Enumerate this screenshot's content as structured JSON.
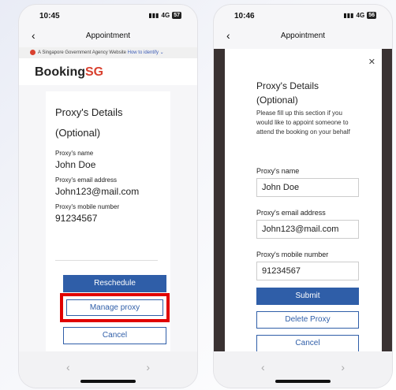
{
  "left_phone": {
    "status_time": "10:45",
    "status_signal": "4G",
    "battery": "57",
    "nav_title": "Appointment",
    "gov_banner_text": "A Singapore Government Agency Website",
    "gov_banner_link": "How to identify",
    "brand_prefix": "Booking",
    "brand_suffix": "SG",
    "proxy_title_line1": "Proxy's Details",
    "proxy_title_line2": "(Optional)",
    "name_label": "Proxy's name",
    "name_value": "John Doe",
    "email_label": "Proxy's email address",
    "email_value": "John123@mail.com",
    "mobile_label": "Proxy's mobile number",
    "mobile_value": "91234567",
    "reschedule_label": "Reschedule",
    "manage_proxy_label": "Manage proxy",
    "cancel_label": "Cancel"
  },
  "right_phone": {
    "status_time": "10:46",
    "status_signal": "4G",
    "battery": "56",
    "nav_title": "Appointment",
    "proxy_title_line1": "Proxy's Details",
    "proxy_title_line2": "(Optional)",
    "helper_text": "Please fill up this section if you would like to appoint someone to attend the booking on your behalf",
    "name_label": "Proxy's name",
    "name_value": "John Doe",
    "email_label": "Proxy's email address",
    "email_value": "John123@mail.com",
    "mobile_label": "Proxy's mobile number",
    "mobile_value": "91234567",
    "submit_label": "Submit",
    "delete_label": "Delete Proxy",
    "cancel_label": "Cancel"
  },
  "colors": {
    "primary": "#2f5ea8",
    "highlight": "#e00000",
    "brand_accent": "#d9412f"
  },
  "icons": [
    "back-chevron-icon",
    "close-icon",
    "prev-chevron-icon",
    "next-chevron-icon",
    "signal-icon",
    "battery-icon"
  ]
}
